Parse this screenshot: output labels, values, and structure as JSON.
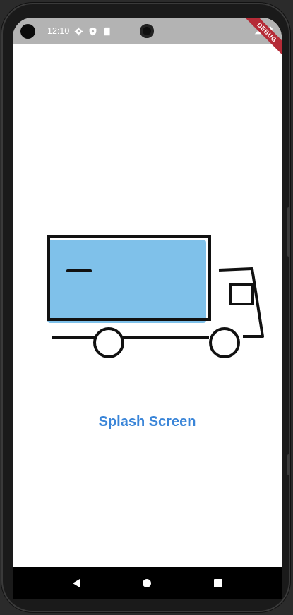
{
  "status_bar": {
    "time": "12:10",
    "icons": [
      "settings-icon",
      "shield-icon",
      "sd-card-icon"
    ],
    "right_icons": [
      "signal-icon",
      "battery-icon"
    ],
    "debug_ribbon": "DEBUG"
  },
  "splash": {
    "title": "Splash Screen",
    "illustration": "delivery-truck-icon",
    "title_color": "#3a85d8",
    "truck_fill_color": "#7fc1ea"
  },
  "nav_bar": {
    "buttons": [
      "back-icon",
      "home-icon",
      "recents-icon"
    ]
  }
}
